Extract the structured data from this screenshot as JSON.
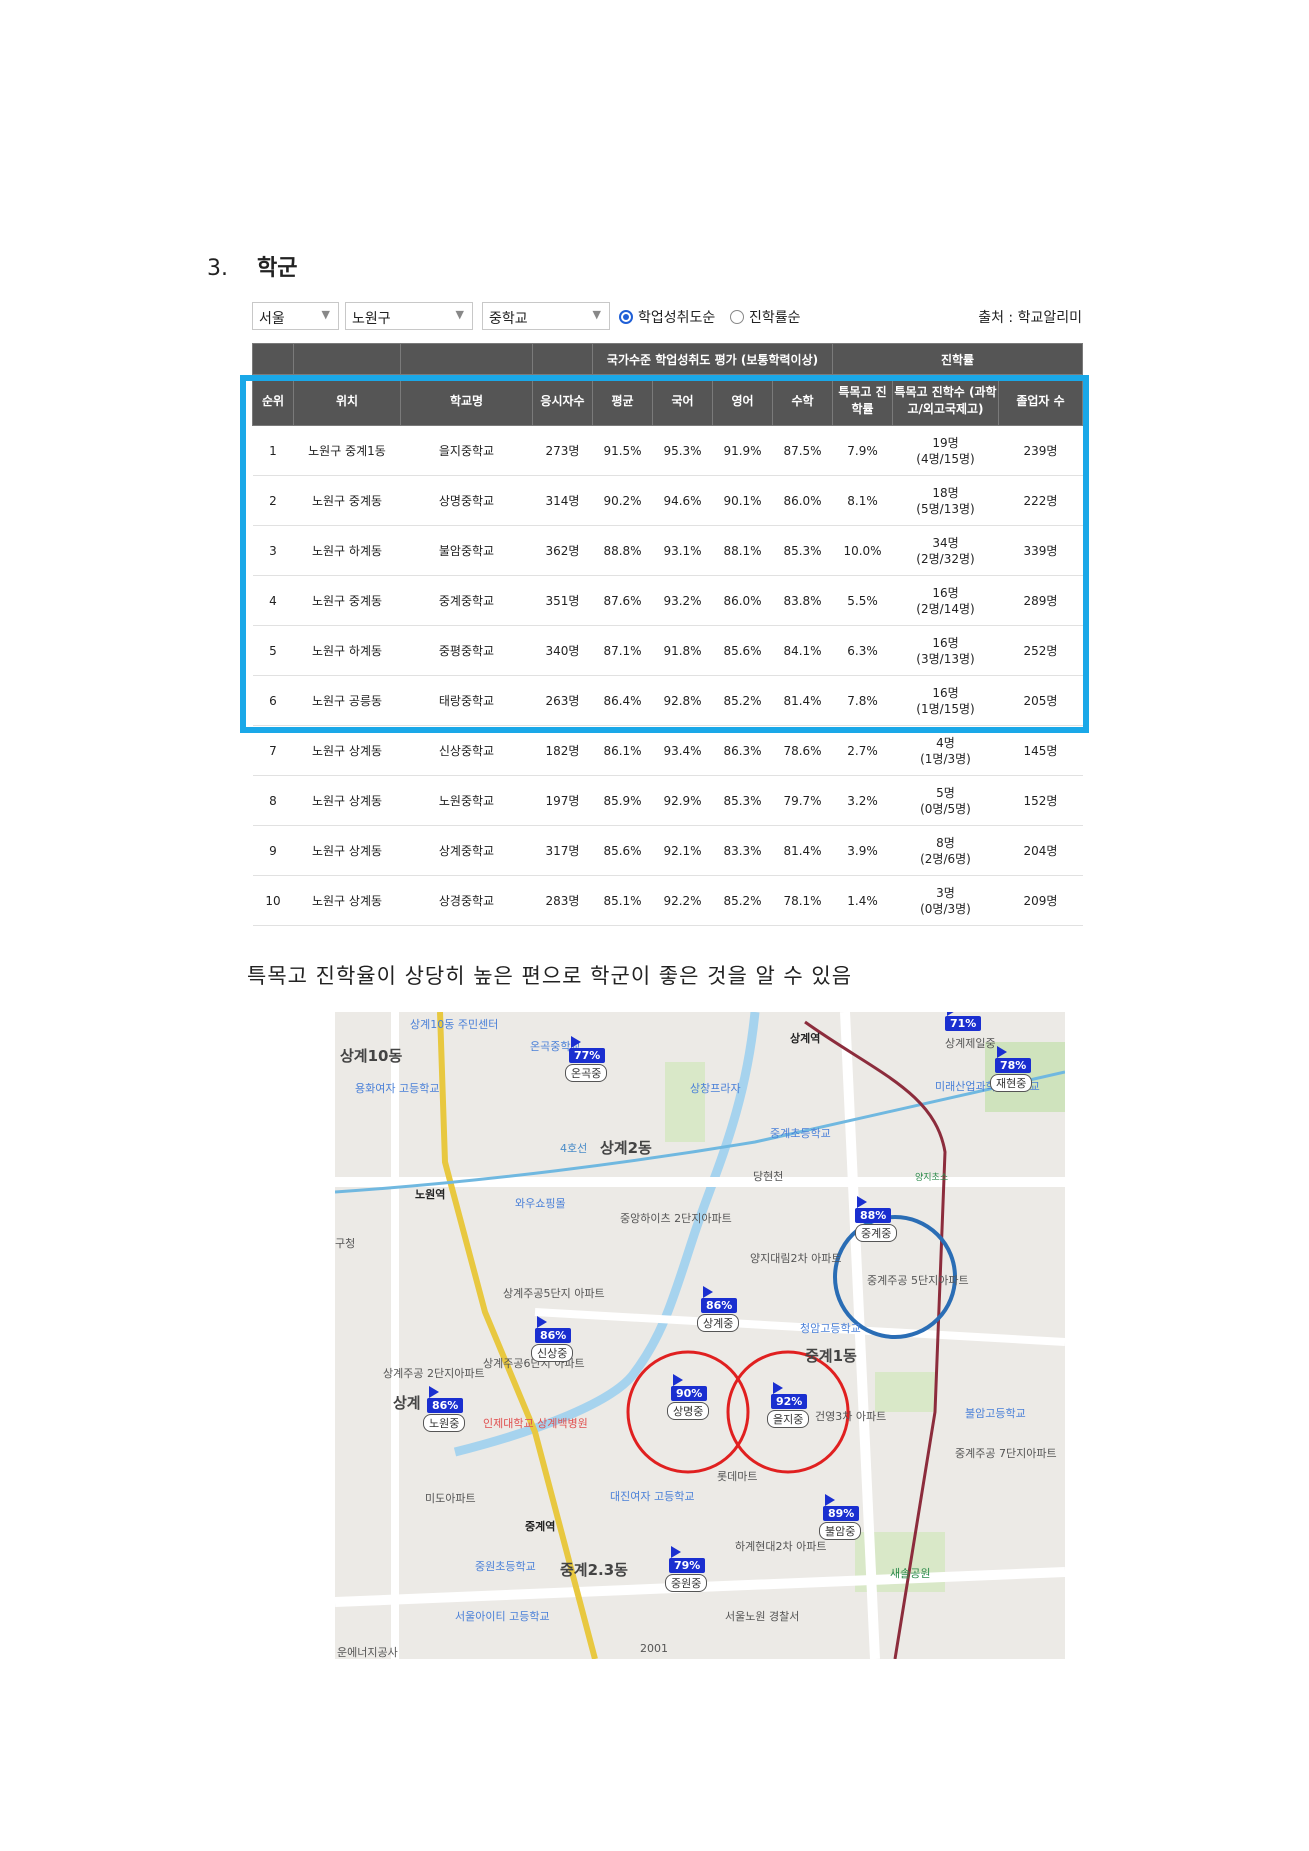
{
  "section": {
    "number": "3.",
    "title": "학군"
  },
  "filters": {
    "city": "서울",
    "district": "노원구",
    "school_type": "중학교",
    "sort_options": [
      "학업성취도순",
      "진학률순"
    ],
    "selected_sort": "학업성취도순",
    "source": "출처 : 학교알리미"
  },
  "table": {
    "group_headers": {
      "achievement": "국가수준 학업성취도 평가 (보통학력이상)",
      "advancement": "진학률"
    },
    "columns": [
      "순위",
      "위치",
      "학교명",
      "응시자수",
      "평균",
      "국어",
      "영어",
      "수학",
      "특목고 진학률",
      "특목고 진학수 (과학고/외고국제고)",
      "졸업자 수"
    ],
    "rows": [
      [
        "1",
        "노원구 중계1동",
        "을지중학교",
        "273명",
        "91.5%",
        "95.3%",
        "91.9%",
        "87.5%",
        "7.9%",
        "19명",
        "(4명/15명)",
        "239명"
      ],
      [
        "2",
        "노원구 중계동",
        "상명중학교",
        "314명",
        "90.2%",
        "94.6%",
        "90.1%",
        "86.0%",
        "8.1%",
        "18명",
        "(5명/13명)",
        "222명"
      ],
      [
        "3",
        "노원구 하계동",
        "불암중학교",
        "362명",
        "88.8%",
        "93.1%",
        "88.1%",
        "85.3%",
        "10.0%",
        "34명",
        "(2명/32명)",
        "339명"
      ],
      [
        "4",
        "노원구 중계동",
        "중계중학교",
        "351명",
        "87.6%",
        "93.2%",
        "86.0%",
        "83.8%",
        "5.5%",
        "16명",
        "(2명/14명)",
        "289명"
      ],
      [
        "5",
        "노원구 하계동",
        "중평중학교",
        "340명",
        "87.1%",
        "91.8%",
        "85.6%",
        "84.1%",
        "6.3%",
        "16명",
        "(3명/13명)",
        "252명"
      ],
      [
        "6",
        "노원구 공릉동",
        "태랑중학교",
        "263명",
        "86.4%",
        "92.8%",
        "85.2%",
        "81.4%",
        "7.8%",
        "16명",
        "(1명/15명)",
        "205명"
      ],
      [
        "7",
        "노원구 상계동",
        "신상중학교",
        "182명",
        "86.1%",
        "93.4%",
        "86.3%",
        "78.6%",
        "2.7%",
        "4명",
        "(1명/3명)",
        "145명"
      ],
      [
        "8",
        "노원구 상계동",
        "노원중학교",
        "197명",
        "85.9%",
        "92.9%",
        "85.3%",
        "79.7%",
        "3.2%",
        "5명",
        "(0명/5명)",
        "152명"
      ],
      [
        "9",
        "노원구 상계동",
        "상계중학교",
        "317명",
        "85.6%",
        "92.1%",
        "83.3%",
        "81.4%",
        "3.9%",
        "8명",
        "(2명/6명)",
        "204명"
      ],
      [
        "10",
        "노원구 상계동",
        "상경중학교",
        "283명",
        "85.1%",
        "92.2%",
        "85.2%",
        "78.1%",
        "1.4%",
        "3명",
        "(0명/3명)",
        "209명"
      ]
    ]
  },
  "comment": "특목고 진학율이 상당히 높은 편으로 학군이 좋은 것을 알 수 있음",
  "map": {
    "areas": [
      "상계10동",
      "상계2동",
      "상계",
      "중계2.3동",
      "중계1동"
    ],
    "stations": [
      "노원역",
      "상계역",
      "중계역"
    ],
    "places": [
      "상계10동 주민센터",
      "용화여자 고등학교",
      "와우쇼핑몰",
      "중앙하이츠 2단지아파트",
      "상계주공5단지 아파트",
      "상계주공 2단지아파트",
      "상계주공6단지 아파트",
      "미도아파트",
      "인제대학교 상계백병원",
      "당현천",
      "중계초등학교",
      "양지대림2차 아파트",
      "중계주공 5단지아파트",
      "청암고등학교",
      "건영3차 아파트",
      "롯데마트",
      "대진여자 고등학교",
      "중원초등학교",
      "하계현대2차 아파트",
      "서울아이티 고등학교",
      "서울노원 경찰서",
      "불암고등학교",
      "중계주공 7단지아파트",
      "미래산업과학 고등학교",
      "새솔공원",
      "상계제일중",
      "상창프라자",
      "온곡중학교",
      "양지초소",
      "2001",
      "운에너지공사",
      "구청"
    ],
    "schools": [
      {
        "name": "온곡중",
        "pct": "77%"
      },
      {
        "name": "상계제일중",
        "pct": "71%"
      },
      {
        "name": "재현중",
        "pct": "78%"
      },
      {
        "name": "중계중",
        "pct": "88%"
      },
      {
        "name": "상계중",
        "pct": "86%"
      },
      {
        "name": "신상중",
        "pct": "86%"
      },
      {
        "name": "노원중",
        "pct": "86%"
      },
      {
        "name": "상명중",
        "pct": "90%"
      },
      {
        "name": "을지중",
        "pct": "92%"
      },
      {
        "name": "불암중",
        "pct": "89%"
      },
      {
        "name": "중원중",
        "pct": "79%"
      }
    ],
    "line_label": "4호선",
    "highlight_colors": {
      "table_box": "#1aa8e8",
      "red_circle": "#e02020",
      "blue_circle": "#2a6db5"
    }
  }
}
